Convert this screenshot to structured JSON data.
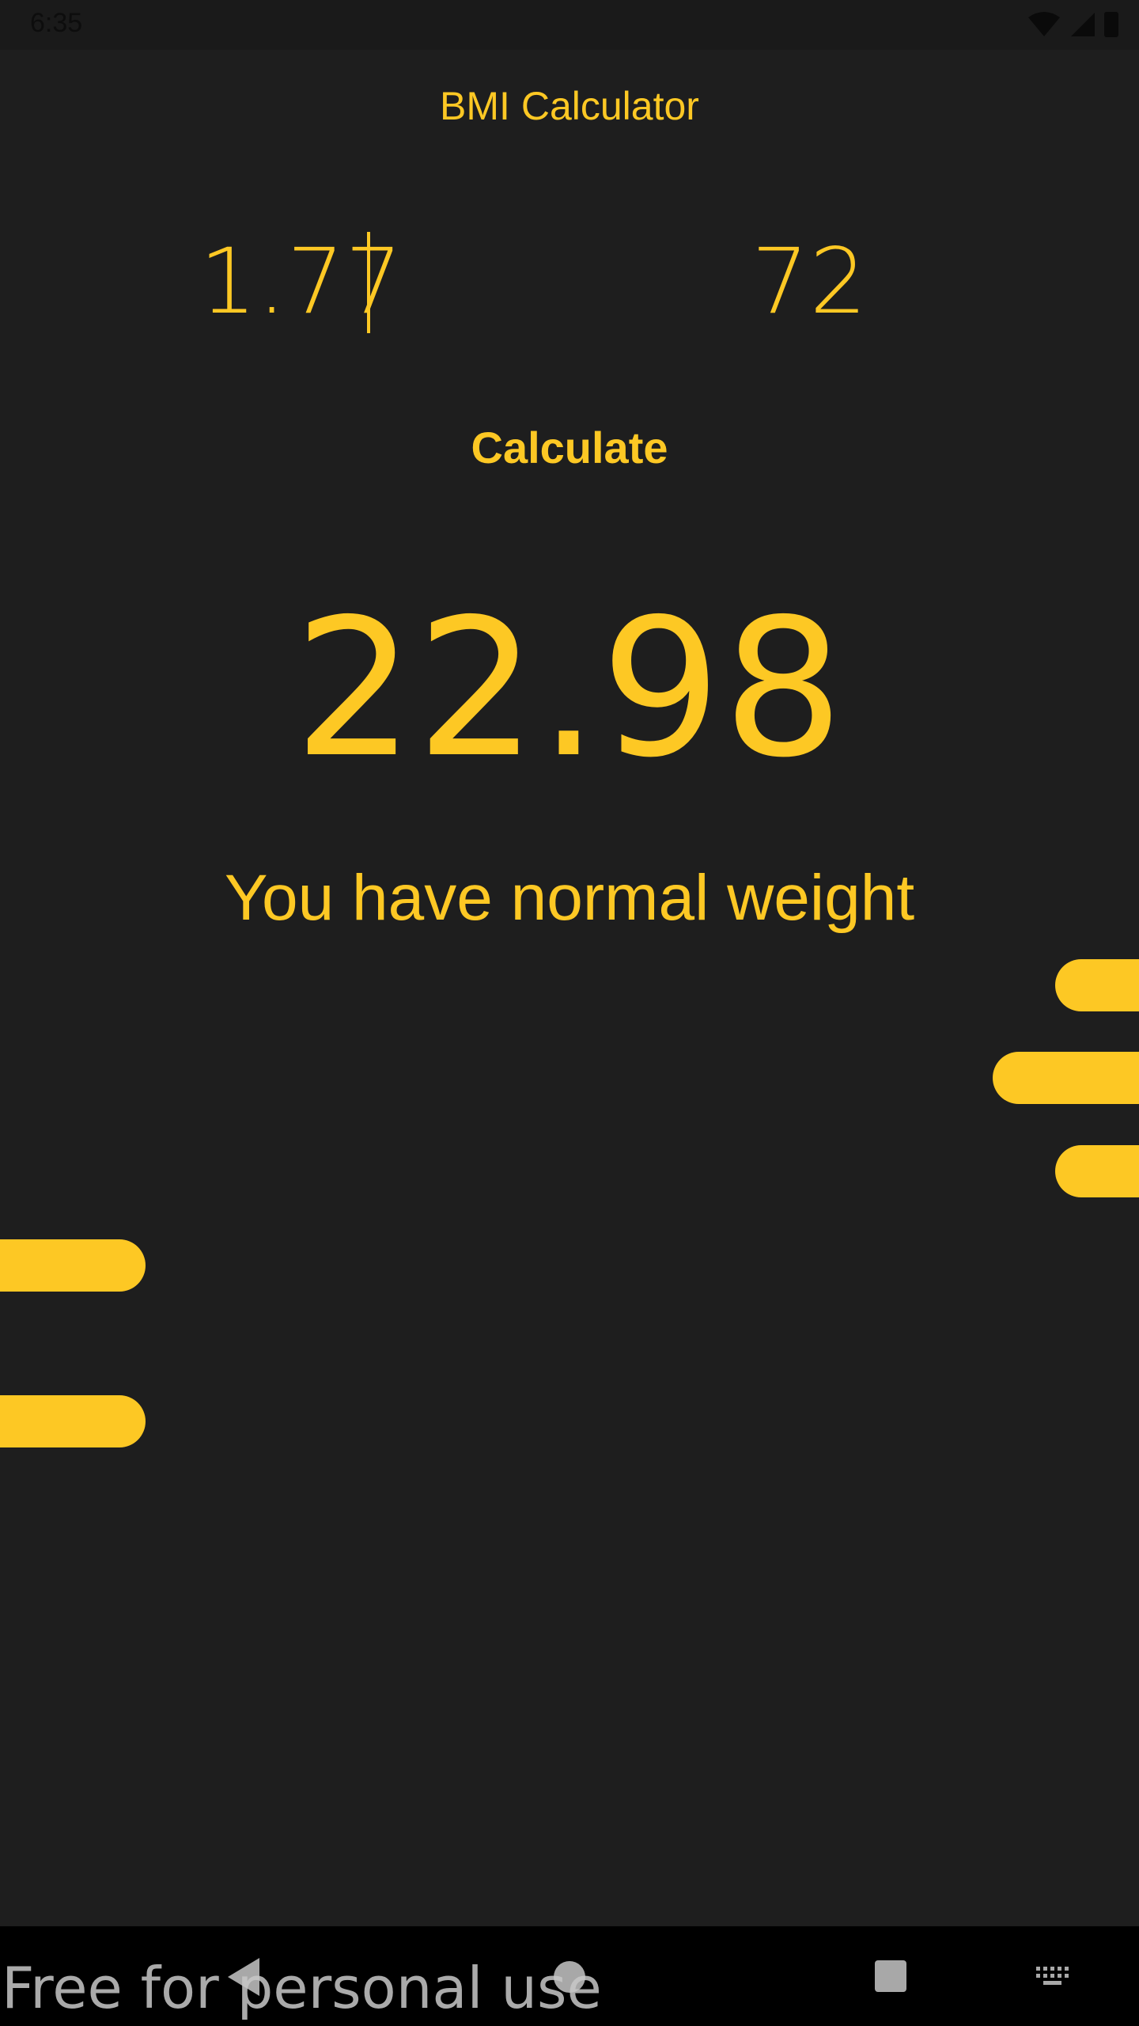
{
  "status_bar": {
    "time": "6:35",
    "icons": [
      "wifi-icon",
      "signal-icon",
      "battery-icon"
    ]
  },
  "app": {
    "title": "BMI Calculator"
  },
  "inputs": {
    "height_value": "1.77",
    "weight_value": "72"
  },
  "actions": {
    "calculate_label": "Calculate"
  },
  "result": {
    "bmi": "22.98",
    "message": "You have normal weight"
  },
  "navigation": {
    "buttons": [
      "back-icon",
      "home-icon",
      "recents-icon",
      "keyboard-icon"
    ]
  },
  "overlay": {
    "watermark": "Free for personal use"
  },
  "colors": {
    "background": "#1e1e1e",
    "accent": "#fdc824",
    "nav_background": "#000000"
  }
}
